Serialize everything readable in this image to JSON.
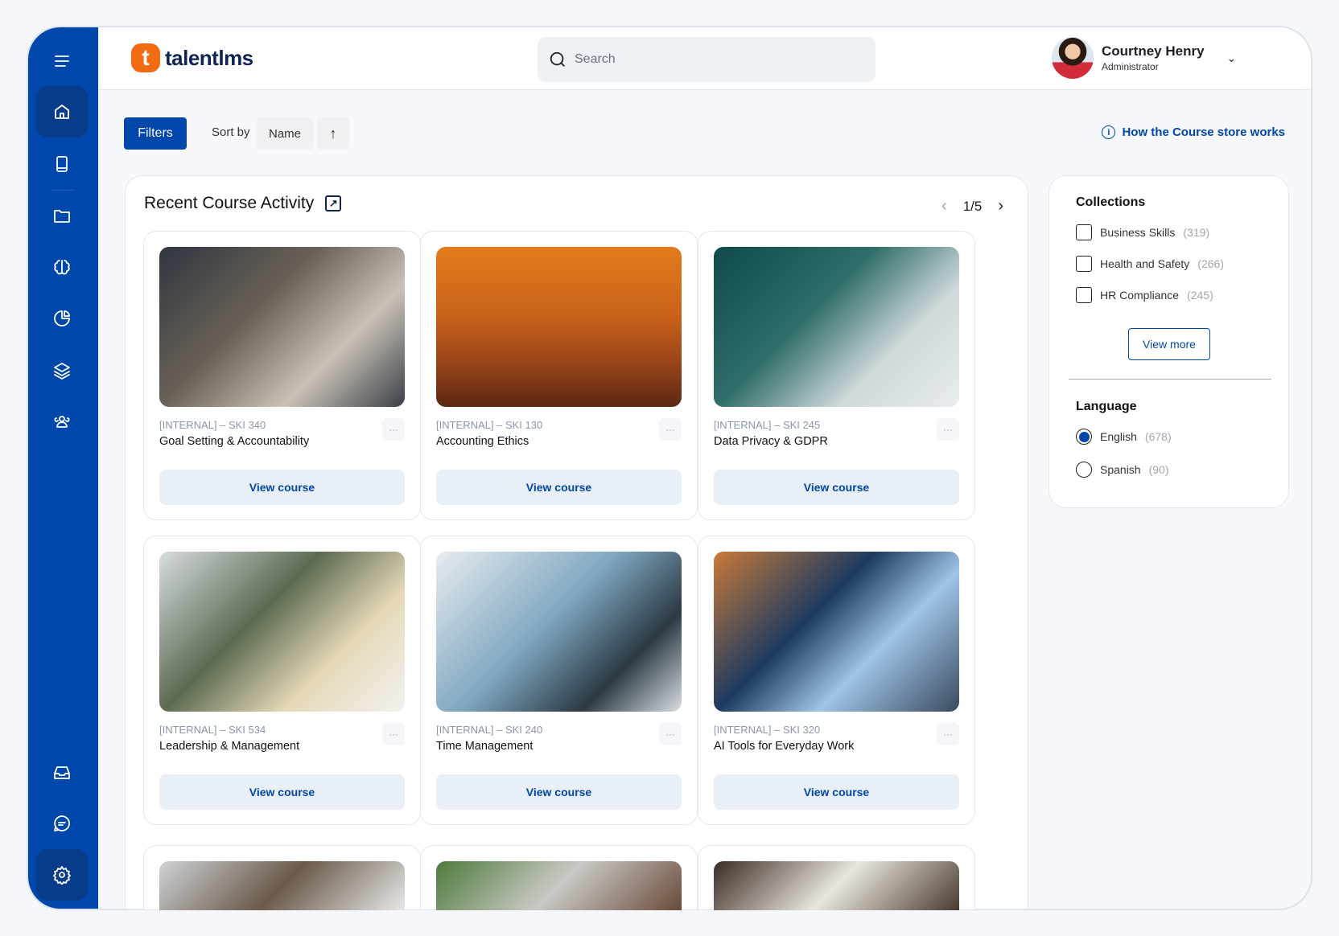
{
  "app": {
    "logo_letter": "t",
    "logo_text": "talentlms"
  },
  "search": {
    "placeholder": "Search"
  },
  "user": {
    "name": "Courtney Henry",
    "role": "Administrator"
  },
  "toolbar": {
    "filters_label": "Filters",
    "sort_by_label": "Sort by",
    "sort_value": "Name",
    "sort_direction": "↑",
    "help_link": "How the Course store works"
  },
  "recent": {
    "title": "Recent Course Activity",
    "page": "1/5"
  },
  "courses": [
    {
      "code": "[INTERNAL] – SKI 340",
      "name": "Goal Setting & Accountability",
      "action": "View course",
      "more": "···"
    },
    {
      "code": "[INTERNAL] – SKI 130",
      "name": "Accounting Ethics",
      "action": "View course",
      "more": "···"
    },
    {
      "code": "[INTERNAL] – SKI 245",
      "name": "Data Privacy & GDPR",
      "action": "View course",
      "more": "···"
    },
    {
      "code": "[INTERNAL] – SKI 534",
      "name": "Leadership & Management",
      "action": "View course",
      "more": "···"
    },
    {
      "code": "[INTERNAL] – SKI 240",
      "name": "Time Management",
      "action": "View course",
      "more": "···"
    },
    {
      "code": "[INTERNAL] – SKI 320",
      "name": "AI Tools for Everyday Work",
      "action": "View course",
      "more": "···"
    }
  ],
  "collections": {
    "title": "Collections",
    "items": [
      {
        "label": "Business Skills",
        "count": "(319)"
      },
      {
        "label": "Health and Safety",
        "count": "(266)"
      },
      {
        "label": "HR Compliance",
        "count": "(245)"
      }
    ],
    "view_more": "View more"
  },
  "language": {
    "title": "Language",
    "items": [
      {
        "label": "English",
        "count": "(678)",
        "selected": true
      },
      {
        "label": "Spanish",
        "count": "(90)",
        "selected": false
      }
    ]
  },
  "colors": {
    "primary": "#0047ab",
    "brand_orange": "#f36b13"
  }
}
